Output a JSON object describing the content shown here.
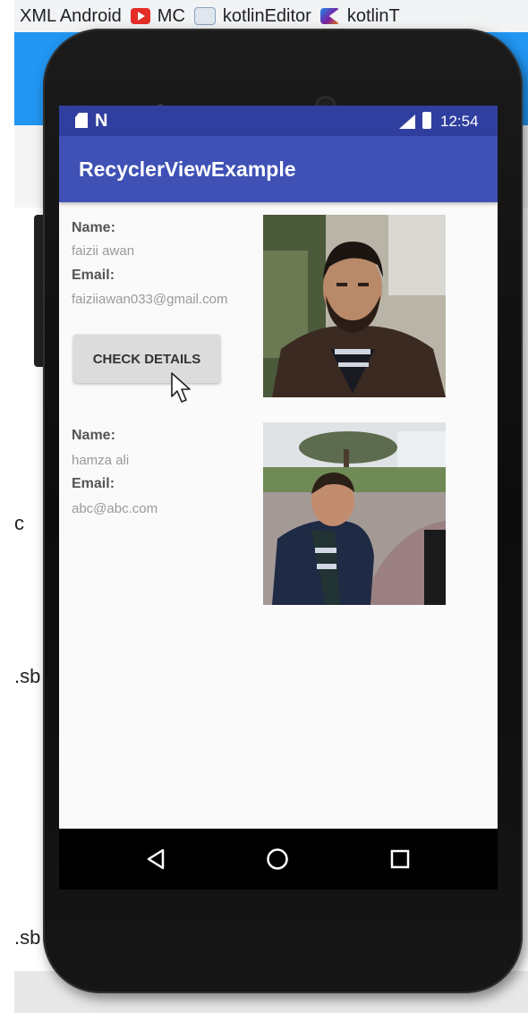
{
  "browser": {
    "bookmarks": [
      {
        "label": "XML Android",
        "icon": "none"
      },
      {
        "label": "MC",
        "icon": "youtube-icon"
      },
      {
        "label": "kotlinEditor",
        "icon": "kotlin-editor-icon"
      },
      {
        "label": "kotlinT",
        "icon": "kotlin-icon"
      }
    ]
  },
  "background": {
    "left_edge_texts": [
      "c",
      ".sb",
      ".sb"
    ]
  },
  "phone": {
    "status_bar": {
      "time": "12:54",
      "icons": [
        "sd-card-icon",
        "n-icon",
        "signal-icon",
        "battery-icon"
      ],
      "n_glyph": "N"
    },
    "app_bar": {
      "title": "RecyclerViewExample"
    },
    "items": [
      {
        "name_label": "Name:",
        "name": "faizii awan",
        "email_label": "Email:",
        "email": "faiziiawan033@gmail.com",
        "button": "CHECK DETAILS",
        "photo": "man-with-beard-in-brown-jacket"
      },
      {
        "name_label": "Name:",
        "name": "hamza ali",
        "email_label": "Email:",
        "email": "abc@abc.com",
        "photo": "man-in-navy-jacket-outdoors"
      }
    ],
    "nav_bar": {
      "icons": [
        "back-icon",
        "home-icon",
        "recents-icon"
      ]
    }
  },
  "colors": {
    "status_bar": "#303f9f",
    "app_bar": "#3f51b5",
    "browser_blue": "#2196f3"
  }
}
